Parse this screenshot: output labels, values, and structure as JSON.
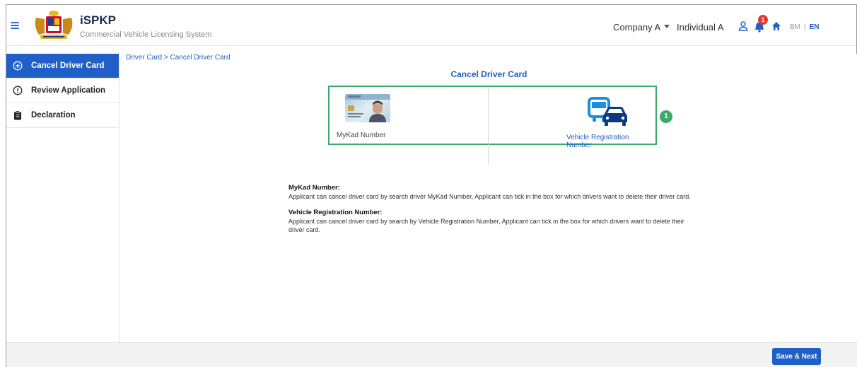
{
  "header": {
    "app_name": "iSPKP",
    "app_subtitle": "Commercial Vehicle Licensing System",
    "company": "Company A",
    "individual": "Individual A",
    "notification_count": "1",
    "lang_bm": "BM",
    "lang_sep": "|",
    "lang_en": "EN",
    "icons": [
      "menu-icon",
      "coat-of-arms-logo",
      "user-icon",
      "bell-icon",
      "home-icon"
    ]
  },
  "sidebar": {
    "items": [
      {
        "label": "Cancel Driver Card",
        "icon": "plus-circle-icon",
        "active": true
      },
      {
        "label": "Review Application",
        "icon": "exclamation-circle-icon",
        "active": false
      },
      {
        "label": "Declaration",
        "icon": "clipboard-icon",
        "active": false
      }
    ]
  },
  "main": {
    "breadcrumb": "Driver Card > Cancel Driver Card",
    "title": "Cancel Driver Card",
    "options": {
      "mykad_label": "MyKad Number",
      "vehicle_label": "Vehicle Registration Number"
    },
    "step_badge": "1",
    "descriptions": [
      {
        "heading": "MyKad Number:",
        "text": "Applicant can cancel driver card by search driver MyKad Number, Applicant can tick in the box for which drivers want to delete their driver card."
      },
      {
        "heading": "Vehicle Registration Number:",
        "text": "Applicant can cancel driver card by search by Vehicle Registration Number, Applicant can tick in the box for which drivers want to delete their driver card."
      }
    ]
  },
  "footer": {
    "save_label": "Save & Next"
  },
  "colors": {
    "primary": "#1f5fc6",
    "highlight_border": "#3aa96b",
    "badge_red": "#e53935"
  }
}
